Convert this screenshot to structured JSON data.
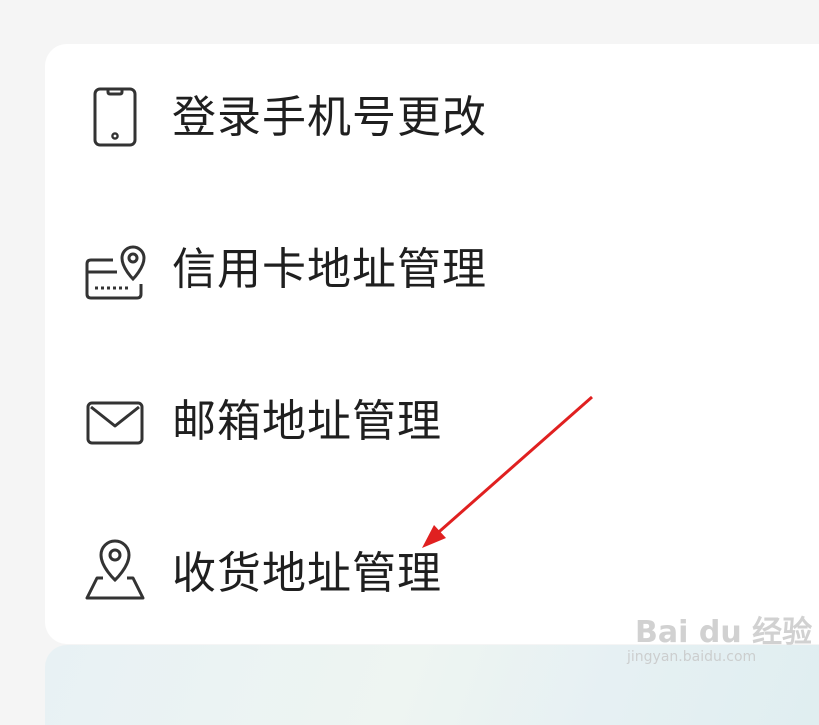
{
  "menu": {
    "items": [
      {
        "label": "登录手机号更改",
        "icon": "phone-icon"
      },
      {
        "label": "信用卡地址管理",
        "icon": "credit-card-location-icon"
      },
      {
        "label": "邮箱地址管理",
        "icon": "mail-icon"
      },
      {
        "label": "收货地址管理",
        "icon": "delivery-location-icon"
      }
    ]
  },
  "annotation": {
    "arrow_color": "#e02020"
  },
  "watermark": {
    "brand": "Bai du 经验",
    "url": "jingyan.baidu.com"
  },
  "colors": {
    "background": "#f5f5f5",
    "card": "#ffffff",
    "text": "#1f1f1f",
    "icon": "#333333"
  }
}
